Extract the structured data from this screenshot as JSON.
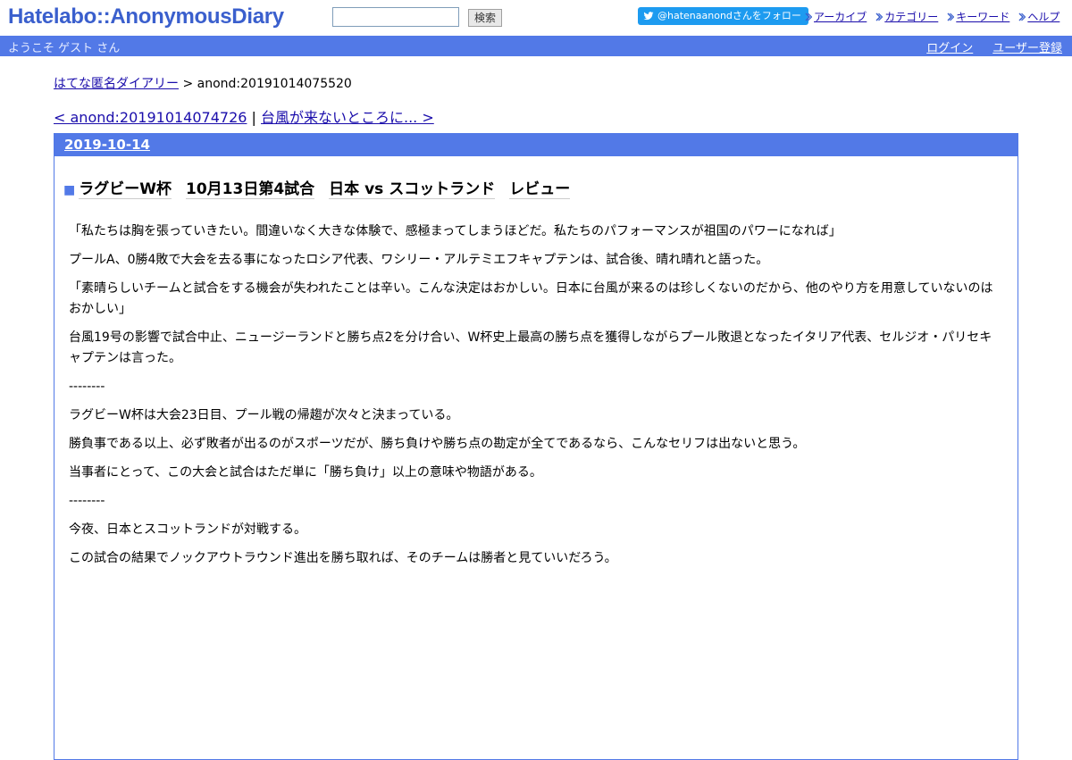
{
  "header": {
    "logo": "Hatelabo::AnonymousDiary",
    "search_placeholder": "",
    "search_button": "検索",
    "follow_button": "@hatenaanondさんをフォロー",
    "links": [
      "アーカイブ",
      "カテゴリー",
      "キーワード",
      "ヘルプ"
    ]
  },
  "navbar": {
    "welcome": "ようこそ ゲスト さん",
    "login": "ログイン",
    "register": "ユーザー登録"
  },
  "breadcrumb": {
    "home": "はてな匿名ダイアリー",
    "separator": " > ",
    "current": "anond:20191014075520"
  },
  "pager": {
    "prev": "< anond:20191014074726",
    "separator": " | ",
    "next": "台風が来ないところに... >"
  },
  "day": {
    "date": "2019-10-14",
    "title_marker": "■",
    "title_parts": [
      "ラグビーW杯",
      "10月13日第4試合",
      "日本 vs スコットランド",
      "レビュー"
    ],
    "paragraphs": [
      "「私たちは胸を張っていきたい。間違いなく大きな体験で、感極まってしまうほどだ。私たちのパフォーマンスが祖国のパワーになれば」",
      "プールA、0勝4敗で大会を去る事になったロシア代表、ワシリー・アルテミエフキャプテンは、試合後、晴れ晴れと語った。",
      "「素晴らしいチームと試合をする機会が失われたことは辛い。こんな決定はおかしい。日本に台風が来るのは珍しくないのだから、他のやり方を用意していないのはおかしい」",
      "台風19号の影響で試合中止、ニュージーランドと勝ち点2を分け合い、W杯史上最高の勝ち点を獲得しながらプール敗退となったイタリア代表、セルジオ・パリセキャプテンは言った。",
      "--------",
      "ラグビーW杯は大会23日目、プール戦の帰趨が次々と決まっている。",
      "勝負事である以上、必ず敗者が出るのがスポーツだが、勝ち負けや勝ち点の勘定が全てであるなら、こんなセリフは出ないと思う。",
      "当事者にとって、この大会と試合はただ単に「勝ち負け」以上の意味や物語がある。",
      "--------",
      "今夜、日本とスコットランドが対戦する。",
      "この試合の結果でノックアウトラウンド進出を勝ち取れば、そのチームは勝者と見ていいだろう。"
    ]
  }
}
